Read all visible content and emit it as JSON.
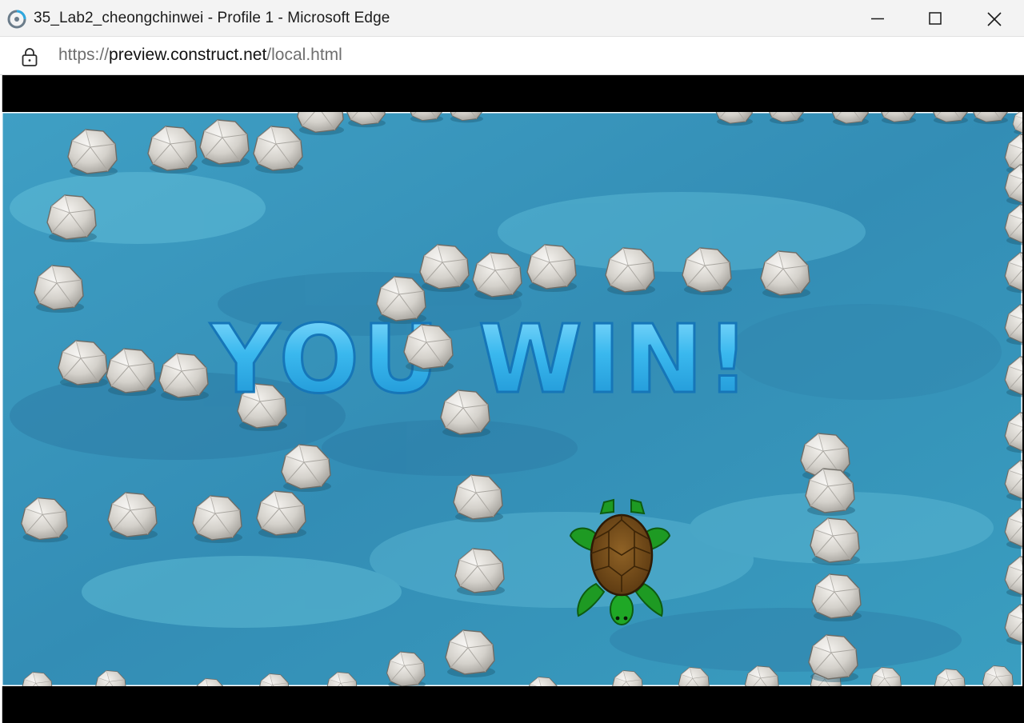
{
  "window": {
    "title": "35_Lab2_cheongchinwei - Profile 1 - Microsoft Edge",
    "app_icon": "edge-app-icon",
    "buttons": [
      "minimize-icon",
      "maximize-icon",
      "close-icon"
    ]
  },
  "address_bar": {
    "url_scheme": "https://",
    "url_host": "preview.construct.net",
    "url_path": "/local.html",
    "security_icon": "lock-icon"
  },
  "game": {
    "message": "YOU WIN!",
    "player": "turtle",
    "background": "water",
    "obstacles": "rocks",
    "colors": {
      "water": "#3aa2c2",
      "water_dark": "#2a7ea6",
      "text": "#37b6ec",
      "turtle_skin": "#1f9a22",
      "turtle_shell": "#7a4d1a",
      "rock": "#d6d3cd",
      "letterbox": "#000000"
    }
  }
}
